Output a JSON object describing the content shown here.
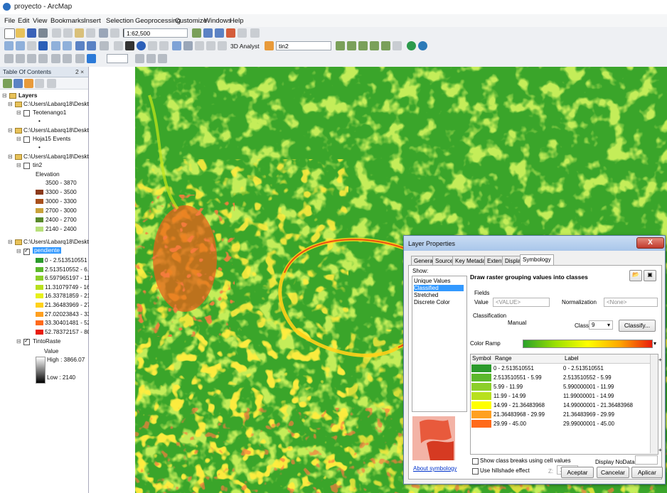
{
  "window": {
    "title": "proyecto - ArcMap"
  },
  "menubar": [
    "File",
    "Edit",
    "View",
    "Bookmarks",
    "Insert",
    "Selection",
    "Geoprocessing",
    "Customize",
    "Windows",
    "Help"
  ],
  "toolbar": {
    "scale": "1:62,500",
    "analyst_label": "3D Analyst",
    "layer_combo": "tin2"
  },
  "toc": {
    "title": "Table Of Contents",
    "pin": "2 ×",
    "root": "Layers",
    "folder_label": "C:\\Users\\Labarq18\\Deskt",
    "layer1": "Teotenango1",
    "layer2": "Hoja15 Events",
    "tin": {
      "name": "tin2",
      "field": "Elevation",
      "classes": [
        {
          "label": "3500 - 3870",
          "color": "#ffffff"
        },
        {
          "label": "3300 - 3500",
          "color": "#8b3a1a"
        },
        {
          "label": "3000 - 3300",
          "color": "#a8501c"
        },
        {
          "label": "2700 - 3000",
          "color": "#c9a23a"
        },
        {
          "label": "2400 - 2700",
          "color": "#5a8a2c"
        },
        {
          "label": "2140 - 2400",
          "color": "#b8e07a"
        }
      ]
    },
    "pendiente": {
      "name": "pendiente",
      "classes": [
        {
          "label": "0 - 2.513510551",
          "color": "#2c9a2c"
        },
        {
          "label": "2.513510552 - 6.597",
          "color": "#5cb82c"
        },
        {
          "label": "6.597965197 - 11.31",
          "color": "#8ccf2a"
        },
        {
          "label": "11.31079749 - 16.33",
          "color": "#b8e01e"
        },
        {
          "label": "16.33781859 - 21.36",
          "color": "#e6f01a"
        },
        {
          "label": "21.36483969 - 27.02",
          "color": "#ffd21a"
        },
        {
          "label": "27.02023843 - 33.30",
          "color": "#ffa020"
        },
        {
          "label": "33.30401481 - 52.78",
          "color": "#ff6a1a"
        },
        {
          "label": "52.78372157 - 80.11",
          "color": "#e81c0c"
        }
      ]
    },
    "tinto": {
      "name": "TintoRaste",
      "value_label": "Value",
      "high": "High : 3866.07",
      "low": "Low : 2140"
    }
  },
  "dialog": {
    "title": "Layer Properties",
    "close": "X",
    "tabs": [
      "General",
      "Source",
      "Key Metadata",
      "Extent",
      "Display",
      "Symbology"
    ],
    "show_label": "Show:",
    "show_items": [
      "Unique Values",
      "Classified",
      "Stretched",
      "Discrete Color"
    ],
    "heading": "Draw raster grouping values into classes",
    "fields_label": "Fields",
    "value_label": "Value",
    "value_combo": "<VALUE>",
    "normalization_label": "Normalization",
    "normalization_combo": "<None>",
    "classification_label": "Classification",
    "method": "Manual",
    "classes_label": "Classes",
    "classes_value": "9",
    "classify_button": "Classify...",
    "color_ramp_label": "Color Ramp",
    "grid_headers": [
      "Symbol",
      "Range",
      "Label"
    ],
    "rows": [
      {
        "range": "0 - 2.513510551",
        "label": "0 - 2.513510551",
        "color": "#2c9a2c"
      },
      {
        "range": "2.513510551 - 5.99",
        "label": "2.513510552 - 5.99",
        "color": "#5cb82c"
      },
      {
        "range": "5.99 - 11.99",
        "label": "5.990000001 - 11.99",
        "color": "#8ccf2a"
      },
      {
        "range": "11.99 - 14.99",
        "label": "11.99000001 - 14.99",
        "color": "#b8e01e"
      },
      {
        "range": "14.99 - 21.36483968",
        "label": "14.99000001 - 21.36483968",
        "color": "#ffff00"
      },
      {
        "range": "21.36483968 - 29.99",
        "label": "21.36483969 - 29.99",
        "color": "#ffa020"
      },
      {
        "range": "29.99 - 45.00",
        "label": "29.99000001 - 45.00",
        "color": "#ff6a1a"
      }
    ],
    "show_breaks": "Show class breaks using cell values",
    "display_nodata": "Display NoData as",
    "hillshade": "Use hillshade effect",
    "z_label": "Z:",
    "z_value": "1",
    "about": "About symbology",
    "ok": "Aceptar",
    "cancel": "Cancelar",
    "apply": "Aplicar"
  }
}
